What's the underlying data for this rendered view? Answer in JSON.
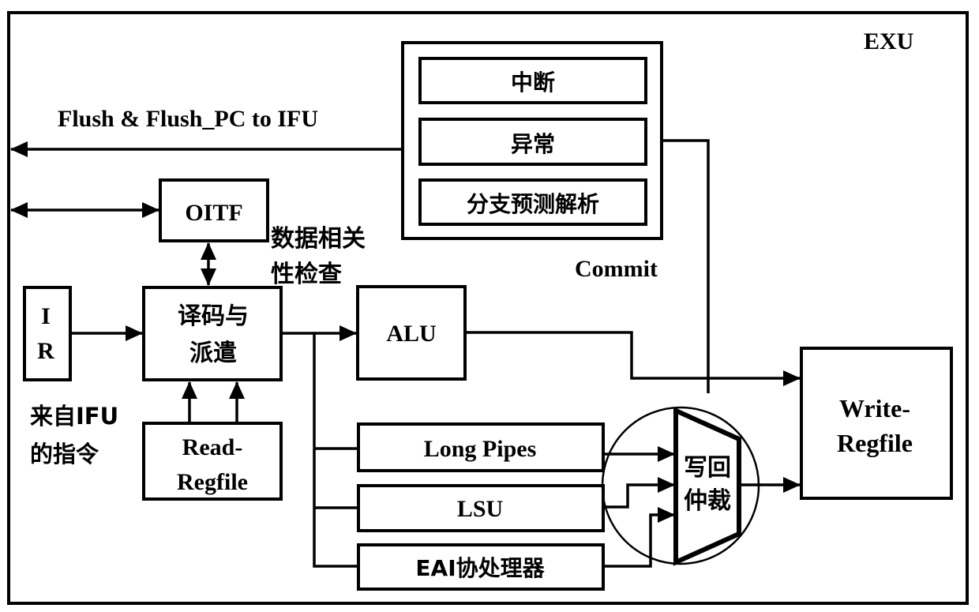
{
  "diagram": {
    "title": "EXU",
    "colors": {
      "stroke": "#000000",
      "background": "#ffffff"
    },
    "signals": {
      "flush": "Flush & Flush_PC to IFU",
      "dependency_check_line1": "数据相关",
      "dependency_check_line2": "性检查",
      "commit": "Commit",
      "from_ifu_line1": "来自IFU",
      "from_ifu_line2": "的指令"
    },
    "blocks": {
      "commit_items": [
        "中断",
        "异常",
        "分支预测解析"
      ],
      "oitf": "OITF",
      "ir_line1": "I",
      "ir_line2": "R",
      "decode_line1": "译码与",
      "decode_line2": "派遣",
      "read_regfile_line1": "Read-",
      "read_regfile_line2": "Regfile",
      "alu": "ALU",
      "long_pipes": "Long Pipes",
      "lsu": "LSU",
      "eai": "EAI协处理器",
      "wb_arbiter_line1": "写回",
      "wb_arbiter_line2": "仲裁",
      "write_regfile_line1": "Write-",
      "write_regfile_line2": "Regfile"
    }
  }
}
